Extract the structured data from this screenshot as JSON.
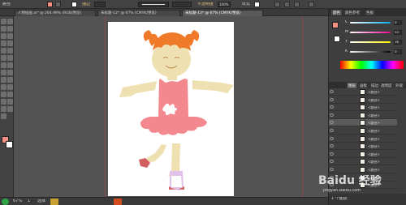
{
  "control_bar": {
    "selection_label": "路径",
    "stroke_label": "描边",
    "opacity_label": "不透明度",
    "opacity_value": "100%",
    "style_label": "样式"
  },
  "tabs": [
    {
      "label": "人物插画.ai* @ 264.99% (RGB/预览)"
    },
    {
      "label": "未标题-12* @ 67% (CMYK/预览)"
    },
    {
      "label": "未标题-13* @ 67% (CMYK/预览)"
    }
  ],
  "tools": [
    "selection-tool-icon",
    "direct-selection-tool-icon",
    "magic-wand-tool-icon",
    "lasso-tool-icon",
    "pen-tool-icon",
    "type-tool-icon",
    "line-tool-icon",
    "rectangle-tool-icon",
    "paintbrush-tool-icon",
    "pencil-tool-icon",
    "eraser-tool-icon",
    "rotate-tool-icon",
    "scale-tool-icon",
    "width-tool-icon",
    "free-transform-tool-icon",
    "shape-builder-tool-icon",
    "perspective-tool-icon",
    "mesh-tool-icon",
    "gradient-tool-icon",
    "eyedropper-tool-icon",
    "blend-tool-icon",
    "symbol-sprayer-tool-icon",
    "graph-tool-icon",
    "artboard-tool-icon",
    "slice-tool-icon",
    "hand-tool-icon",
    "zoom-tool-icon"
  ],
  "colors": {
    "fill": "#f48f84",
    "hair": "#ee7a2a",
    "skin": "#efe0b1",
    "dress": "#f4888f",
    "shoe": "#d35e62",
    "collar": "#e2c2ea",
    "face_line": "#c08a52",
    "accent": "#c8c0f8"
  },
  "right_panel": {
    "top_tabs": [
      "颜色",
      "颜色参考",
      "色板"
    ],
    "color_channels": [
      {
        "name": "C",
        "value": "0"
      },
      {
        "name": "M",
        "value": "55"
      },
      {
        "name": "Y",
        "value": "36"
      },
      {
        "name": "K",
        "value": "0"
      }
    ],
    "layer_tabs": [
      "图层",
      "画板",
      "描边",
      "透明度",
      "外观"
    ],
    "layers": [
      {
        "name": "<路径>"
      },
      {
        "name": "<路径>"
      },
      {
        "name": "<路径>"
      },
      {
        "name": "<路径>"
      },
      {
        "name": "<路径>"
      },
      {
        "name": "<路径>"
      },
      {
        "name": "<路径>"
      },
      {
        "name": "<路径>"
      },
      {
        "name": "<路径>"
      },
      {
        "name": "<路径>"
      },
      {
        "name": "<路径>"
      },
      {
        "name": "<路径>"
      },
      {
        "name": "<路径>"
      }
    ],
    "layer_count": "1 个图层"
  },
  "status_bar": {
    "zoom": "67%",
    "page": "1",
    "tool_name": "选择"
  },
  "watermark": {
    "brand": "Baidu 经验",
    "url": "jingyan.baidu.com"
  }
}
